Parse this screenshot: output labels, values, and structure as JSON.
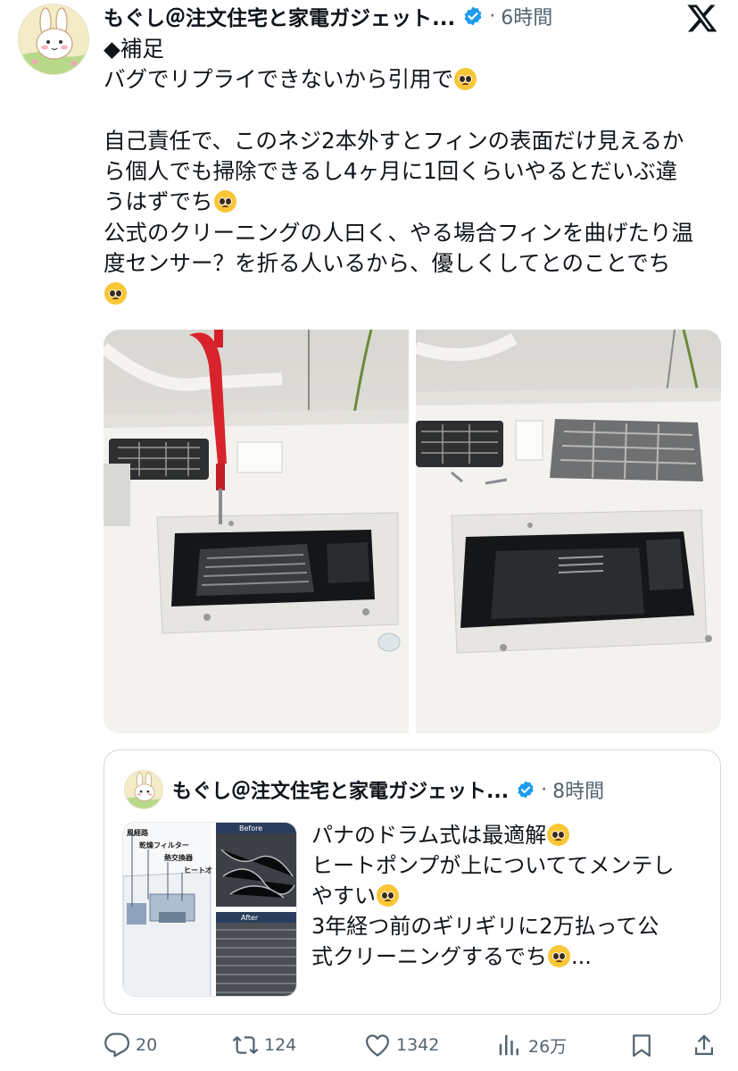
{
  "post": {
    "author": "もぐし＠注文住宅と家電ガジェット...",
    "separator": "·",
    "time": "6時間",
    "lines": [
      "◆補足",
      "バグでリプライできないから引用で",
      "",
      "自己責任で、このネジ2本外すとフィンの表面だけ見えるか",
      "ら個人でも掃除できるし4ヶ月に1回くらいやるとだいぶ違",
      "うはずでち",
      "公式のクリーニングの人曰く、やる場合フィンを曲げたり温",
      "度センサー？を折る人いるから、優しくしてとのことでち",
      ""
    ]
  },
  "quote": {
    "author": "もぐし＠注文住宅と家電ガジェット...",
    "separator": "·",
    "time": "8時間",
    "lines": [
      "パナのドラム式は最適解",
      "ヒートポンプが上についててメンテし",
      "やすい",
      "3年経つ前のギリギリに2万払って公",
      "式クリーニングするでち",
      "..."
    ],
    "diagram_labels": [
      "風経路",
      "乾燥フィルター",
      "熱交換器",
      "ヒート才"
    ],
    "before_label": "Before",
    "after_label": "After"
  },
  "actions": {
    "replies": "20",
    "reposts": "124",
    "likes": "1342",
    "views": "26万"
  },
  "colors": {
    "verified": "#1d9bf0",
    "text": "#0f1419",
    "muted": "#536471",
    "border": "#cfd9de"
  },
  "icons": [
    "x-logo-icon",
    "verified-badge-icon",
    "pleading-face-emoji",
    "reply-icon",
    "repost-icon",
    "like-icon",
    "views-icon",
    "bookmark-icon",
    "share-icon"
  ]
}
